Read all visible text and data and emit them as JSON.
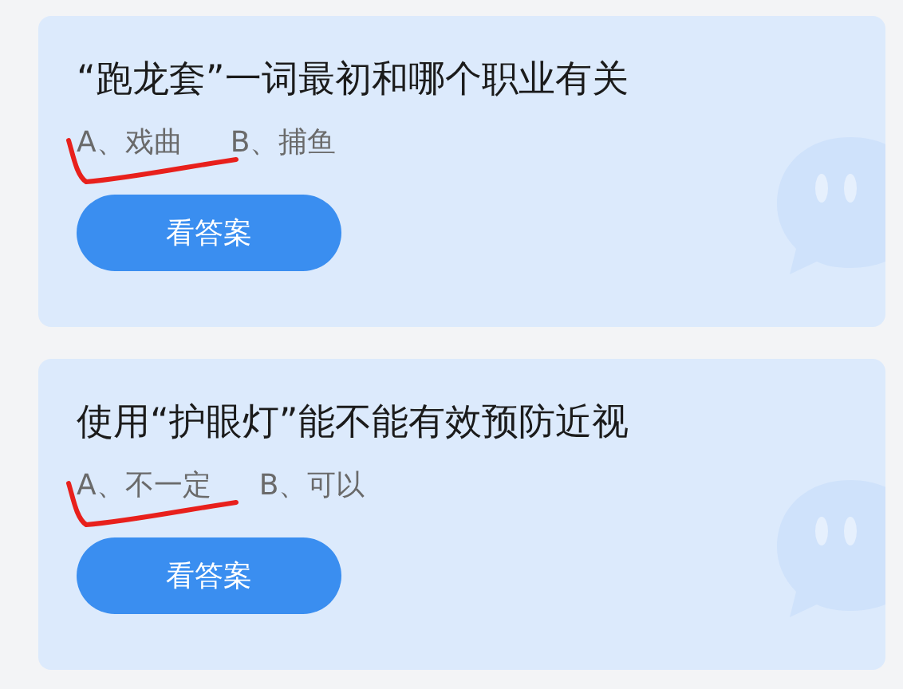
{
  "questions": [
    {
      "title": "“跑龙套”一词最初和哪个职业有关",
      "options": [
        "A、戏曲",
        "B、捕鱼"
      ],
      "button": "看答案"
    },
    {
      "title": "使用“护眼灯”能不能有效预防近视",
      "options": [
        "A、不一定",
        "B、可以"
      ],
      "button": "看答案"
    }
  ]
}
